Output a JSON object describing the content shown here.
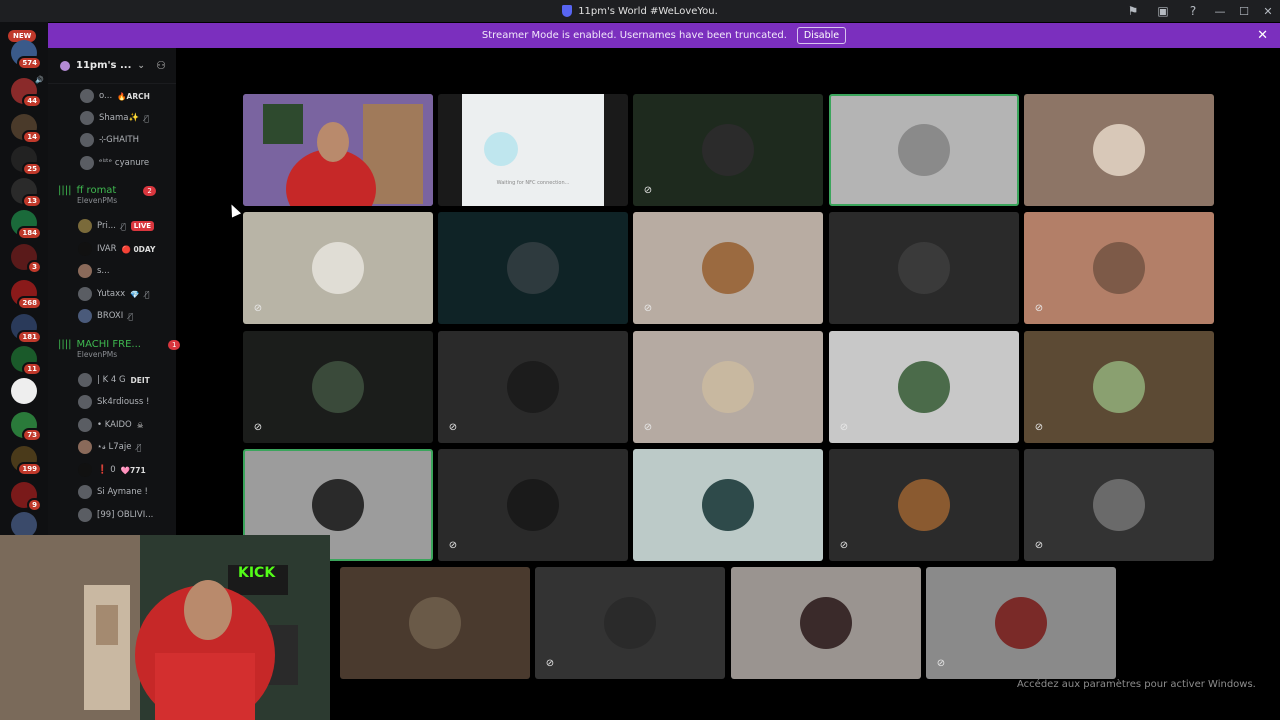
{
  "window": {
    "title": "11pm's World #WeLoveYou.",
    "controls": {
      "minimize": "—",
      "maximize": "☐",
      "close": "✕"
    },
    "toolbar_icons": [
      "flag-icon",
      "inbox-icon",
      "help-icon"
    ]
  },
  "banner": {
    "message": "Streamer Mode is enabled. Usernames have been truncated.",
    "button": "Disable",
    "color": "#7b2fbe"
  },
  "servers": {
    "new_label": "NEW",
    "badges": [
      "574",
      "44",
      "14",
      "25",
      "13",
      "184",
      "3",
      "268",
      "181",
      "11",
      "73",
      "199",
      "9"
    ]
  },
  "channel_panel": {
    "server_name": "11pm's ...",
    "members_top": [
      {
        "name": "o...",
        "tag": "🔥ARCH"
      },
      {
        "name": "Shama✨",
        "tag": ""
      },
      {
        "name": "⊹GHAITH",
        "tag": ""
      },
      {
        "name": "ᵉˡᶦᵗᵉ cyanure",
        "tag": ""
      }
    ],
    "voice1": {
      "name": "ff romat",
      "sub": "ElevenPMs",
      "count": "2"
    },
    "members_v1": [
      {
        "name": "Pri...",
        "live": "LIVE"
      },
      {
        "name": "IVAR",
        "tag": "🔴 0DAY"
      },
      {
        "name": "s...",
        "tag": ""
      },
      {
        "name": "Yutaxx",
        "tag": "💎"
      },
      {
        "name": "BROXI",
        "tag": ""
      }
    ],
    "voice2": {
      "name": "MACHI FRE...",
      "sub": "ElevenPMs",
      "count": "1"
    },
    "members_v2": [
      {
        "name": "| K 4 G",
        "tag": "DEIT"
      },
      {
        "name": "Sk4rdiouss !",
        "tag": ""
      },
      {
        "name": "• KAIDO",
        "tag": "☠"
      },
      {
        "name": "⋆𝓼 L7aje",
        "tag": ""
      },
      {
        "name": "❗ 0",
        "tag": "🩷771"
      },
      {
        "name": "Si Aymane !",
        "tag": ""
      },
      {
        "name": "[99] OBLIVI...",
        "tag": ""
      }
    ]
  },
  "grid": {
    "tiles": [
      {
        "bg": "#6b5a8c",
        "avatar": "",
        "type": "camera",
        "muted": false,
        "speaking": false
      },
      {
        "bg": "#e8e8e8",
        "avatar": "",
        "type": "screen",
        "muted": false,
        "speaking": false,
        "caption": "Waiting for NFC connection..."
      },
      {
        "bg": "#1e2a1e",
        "avatar": "#2b2b2b",
        "muted": true,
        "speaking": false
      },
      {
        "bg": "#b4b4b4",
        "avatar": "#8a8a8a",
        "muted": false,
        "speaking": true
      },
      {
        "bg": "#8d7566",
        "avatar": "#d8c8b8",
        "muted": false,
        "speaking": false
      },
      {
        "bg": "#b8b4a6",
        "avatar": "#e0ddd5",
        "muted": true,
        "speaking": false
      },
      {
        "bg": "#0f2326",
        "avatar": "#2e3a3e",
        "muted": false,
        "speaking": false
      },
      {
        "bg": "#b8aca2",
        "avatar": "#9b6a40",
        "muted": true,
        "speaking": false
      },
      {
        "bg": "#2a2a2a",
        "avatar": "#3a3a3a",
        "muted": false,
        "speaking": false
      },
      {
        "bg": "#b37f68",
        "avatar": "#7d5a48",
        "muted": true,
        "speaking": false
      },
      {
        "bg": "#1b1d1b",
        "avatar": "#3a4a3a",
        "muted": true,
        "speaking": false
      },
      {
        "bg": "#2a2a2a",
        "avatar": "#1c1c1c",
        "muted": true,
        "speaking": false
      },
      {
        "bg": "#b5aaa2",
        "avatar": "#c8b8a0",
        "muted": true,
        "speaking": false
      },
      {
        "bg": "#c8c8c8",
        "avatar": "#4b6b4a",
        "muted": true,
        "speaking": false
      },
      {
        "bg": "#5c4a34",
        "avatar": "#8aa070",
        "muted": true,
        "speaking": false
      },
      {
        "bg": "#9c9c9c",
        "avatar": "#2a2a2a",
        "muted": false,
        "speaking": true
      },
      {
        "bg": "#2a2a2a",
        "avatar": "#1a1a1a",
        "muted": true,
        "speaking": false
      },
      {
        "bg": "#bccac8",
        "avatar": "#2e4a4a",
        "muted": false,
        "speaking": false
      },
      {
        "bg": "#2b2b2b",
        "avatar": "#8a5a30",
        "muted": true,
        "speaking": false
      },
      {
        "bg": "#333333",
        "avatar": "#6a6a6a",
        "muted": true,
        "speaking": false
      },
      {
        "bg": "#4a3a2e",
        "avatar": "#6a5a48",
        "muted": false,
        "speaking": false
      },
      {
        "bg": "#333333",
        "avatar": "#2a2a2a",
        "muted": true,
        "speaking": false
      },
      {
        "bg": "#9a9490",
        "avatar": "#3a2a2a",
        "muted": false,
        "speaking": false
      },
      {
        "bg": "#8a8a8a",
        "avatar": "#7a2a28",
        "muted": true,
        "speaking": false
      }
    ]
  },
  "camera_overlay": {
    "sign": "KICK"
  },
  "windows_notice": "Accédez aux paramètres pour activer Windows."
}
